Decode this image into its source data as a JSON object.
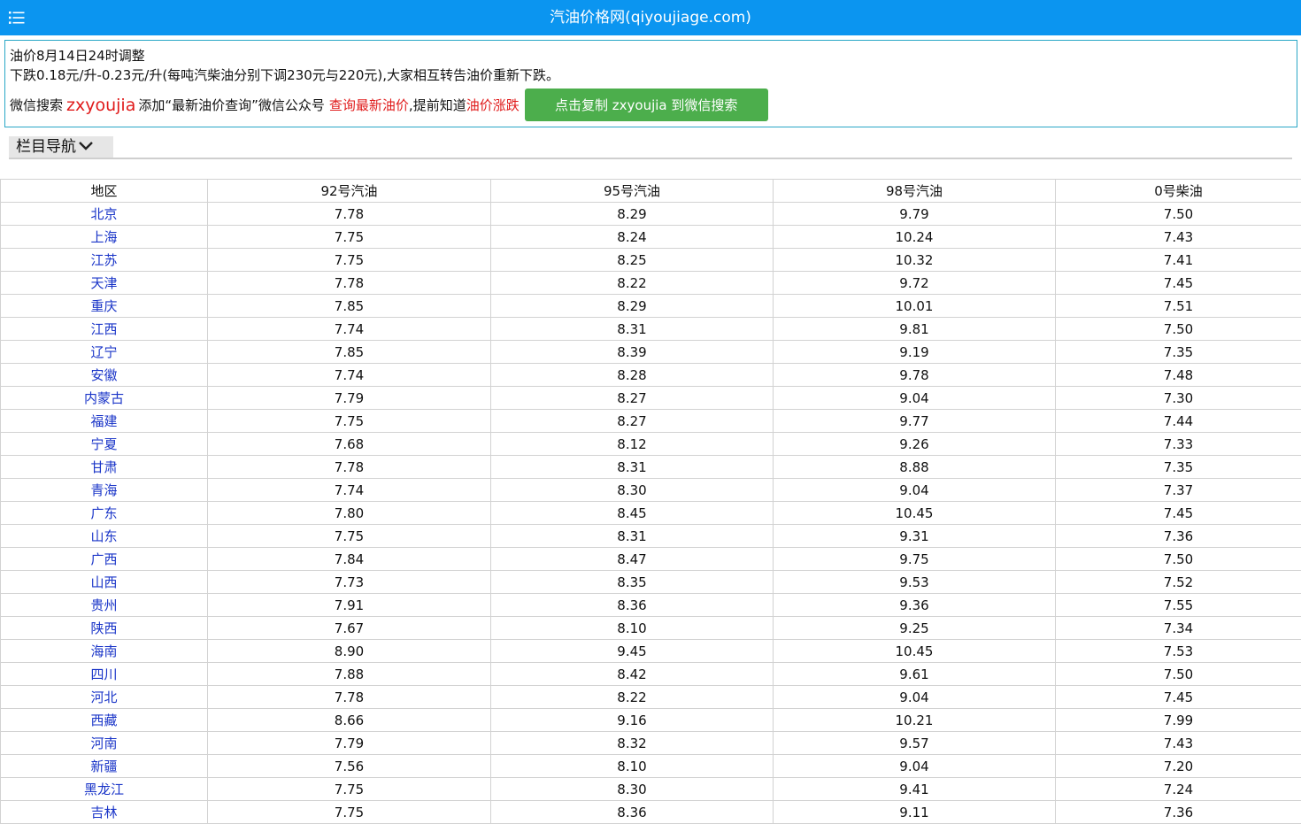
{
  "header": {
    "title": "汽油价格网(qiyoujiage.com)",
    "menu_icon": "menu-list-icon"
  },
  "notice": {
    "line1": "油价8月14日24时调整",
    "line2": "下跌0.18元/升-0.23元/升(每吨汽柴油分别下调230元与220元),大家相互转告油价重新下跌。",
    "wx_prefix": "微信搜索",
    "wx_id": "zxyoujia",
    "wx_mid": "添加“最新油价查询”微信公众号",
    "link_query": "查询最新油价",
    "wx_mid2": ",提前知道",
    "link_trend": "油价涨跌",
    "copy_button": "点击复制 zxyoujia 到微信搜索"
  },
  "nav": {
    "label": "栏目导航"
  },
  "colors": {
    "topbar": "#0b95f0",
    "region_link": "#1a35c8",
    "highlight": "#e01b1b",
    "button": "#4cae4c"
  },
  "table": {
    "headers": [
      "地区",
      "92号汽油",
      "95号汽油",
      "98号汽油",
      "0号柴油"
    ],
    "rows": [
      [
        "北京",
        "7.78",
        "8.29",
        "9.79",
        "7.50"
      ],
      [
        "上海",
        "7.75",
        "8.24",
        "10.24",
        "7.43"
      ],
      [
        "江苏",
        "7.75",
        "8.25",
        "10.32",
        "7.41"
      ],
      [
        "天津",
        "7.78",
        "8.22",
        "9.72",
        "7.45"
      ],
      [
        "重庆",
        "7.85",
        "8.29",
        "10.01",
        "7.51"
      ],
      [
        "江西",
        "7.74",
        "8.31",
        "9.81",
        "7.50"
      ],
      [
        "辽宁",
        "7.85",
        "8.39",
        "9.19",
        "7.35"
      ],
      [
        "安徽",
        "7.74",
        "8.28",
        "9.78",
        "7.48"
      ],
      [
        "内蒙古",
        "7.79",
        "8.27",
        "9.04",
        "7.30"
      ],
      [
        "福建",
        "7.75",
        "8.27",
        "9.77",
        "7.44"
      ],
      [
        "宁夏",
        "7.68",
        "8.12",
        "9.26",
        "7.33"
      ],
      [
        "甘肃",
        "7.78",
        "8.31",
        "8.88",
        "7.35"
      ],
      [
        "青海",
        "7.74",
        "8.30",
        "9.04",
        "7.37"
      ],
      [
        "广东",
        "7.80",
        "8.45",
        "10.45",
        "7.45"
      ],
      [
        "山东",
        "7.75",
        "8.31",
        "9.31",
        "7.36"
      ],
      [
        "广西",
        "7.84",
        "8.47",
        "9.75",
        "7.50"
      ],
      [
        "山西",
        "7.73",
        "8.35",
        "9.53",
        "7.52"
      ],
      [
        "贵州",
        "7.91",
        "8.36",
        "9.36",
        "7.55"
      ],
      [
        "陕西",
        "7.67",
        "8.10",
        "9.25",
        "7.34"
      ],
      [
        "海南",
        "8.90",
        "9.45",
        "10.45",
        "7.53"
      ],
      [
        "四川",
        "7.88",
        "8.42",
        "9.61",
        "7.50"
      ],
      [
        "河北",
        "7.78",
        "8.22",
        "9.04",
        "7.45"
      ],
      [
        "西藏",
        "8.66",
        "9.16",
        "10.21",
        "7.99"
      ],
      [
        "河南",
        "7.79",
        "8.32",
        "9.57",
        "7.43"
      ],
      [
        "新疆",
        "7.56",
        "8.10",
        "9.04",
        "7.20"
      ],
      [
        "黑龙江",
        "7.75",
        "8.30",
        "9.41",
        "7.24"
      ],
      [
        "吉林",
        "7.75",
        "8.36",
        "9.11",
        "7.36"
      ]
    ]
  }
}
